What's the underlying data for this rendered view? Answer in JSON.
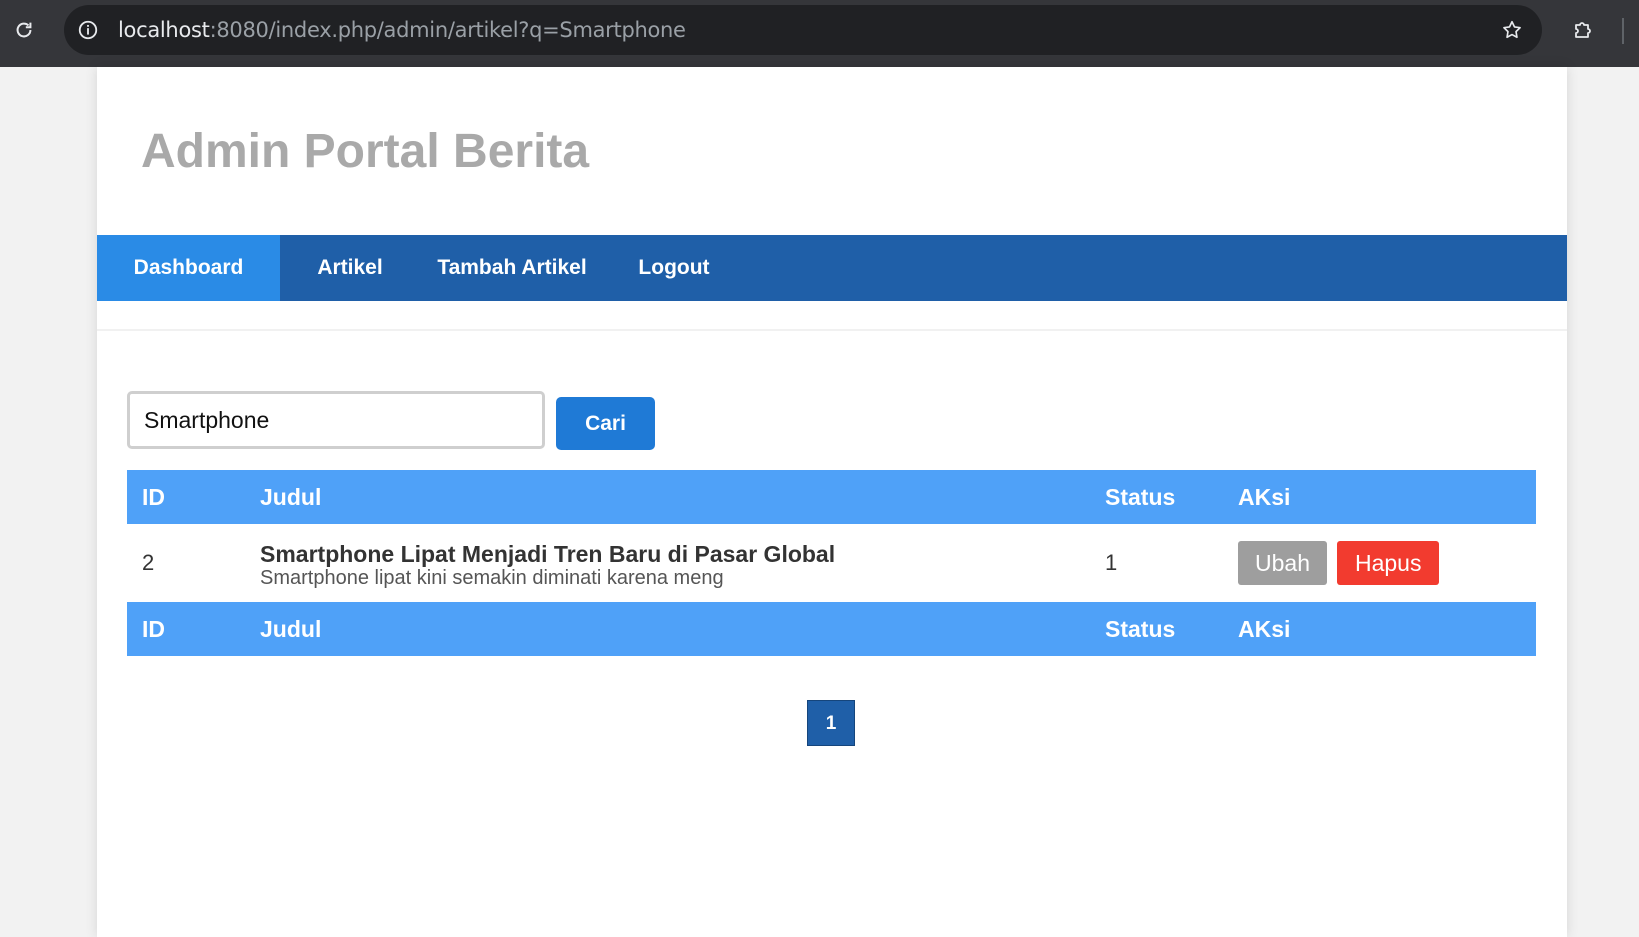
{
  "browser": {
    "url_host": "localhost",
    "url_rest": ":8080/index.php/admin/artikel?q=Smartphone"
  },
  "header": {
    "title": "Admin Portal Berita"
  },
  "nav": {
    "items": [
      {
        "label": "Dashboard",
        "active": true
      },
      {
        "label": "Artikel"
      },
      {
        "label": "Tambah Artikel"
      },
      {
        "label": "Logout"
      }
    ]
  },
  "search": {
    "value": "Smartphone",
    "button_label": "Cari"
  },
  "table": {
    "headers": {
      "id": "ID",
      "judul": "Judul",
      "status": "Status",
      "aksi": "AKsi"
    },
    "rows": [
      {
        "id": "2",
        "title": "Smartphone Lipat Menjadi Tren Baru di Pasar Global",
        "snippet": "Smartphone lipat kini semakin diminati karena meng",
        "status": "1",
        "edit_label": "Ubah",
        "delete_label": "Hapus"
      }
    ]
  },
  "pagination": {
    "pages": [
      "1"
    ],
    "current": "1"
  },
  "colors": {
    "nav": "#1f5fa8",
    "nav_active": "#2a8be6",
    "table_header": "#4fa1f8",
    "delete": "#f23b2f",
    "edit": "#9e9e9e"
  }
}
